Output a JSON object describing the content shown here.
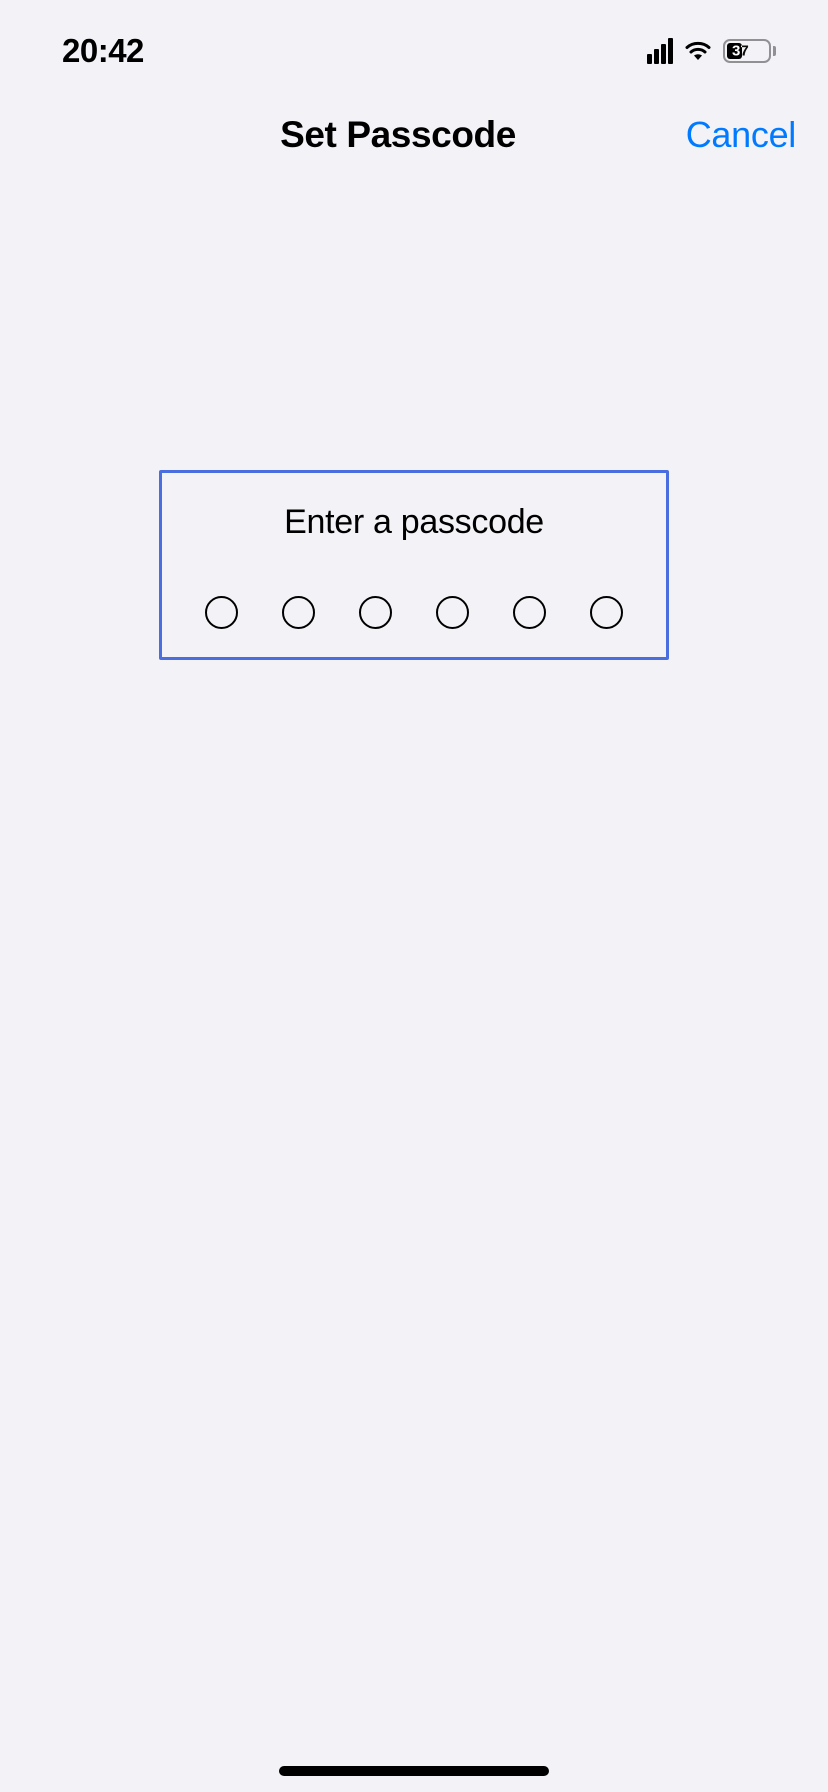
{
  "status_bar": {
    "time": "20:42",
    "battery_percent": "37"
  },
  "nav": {
    "title": "Set Passcode",
    "cancel_label": "Cancel"
  },
  "passcode": {
    "prompt": "Enter a passcode",
    "digit_count": 6
  }
}
